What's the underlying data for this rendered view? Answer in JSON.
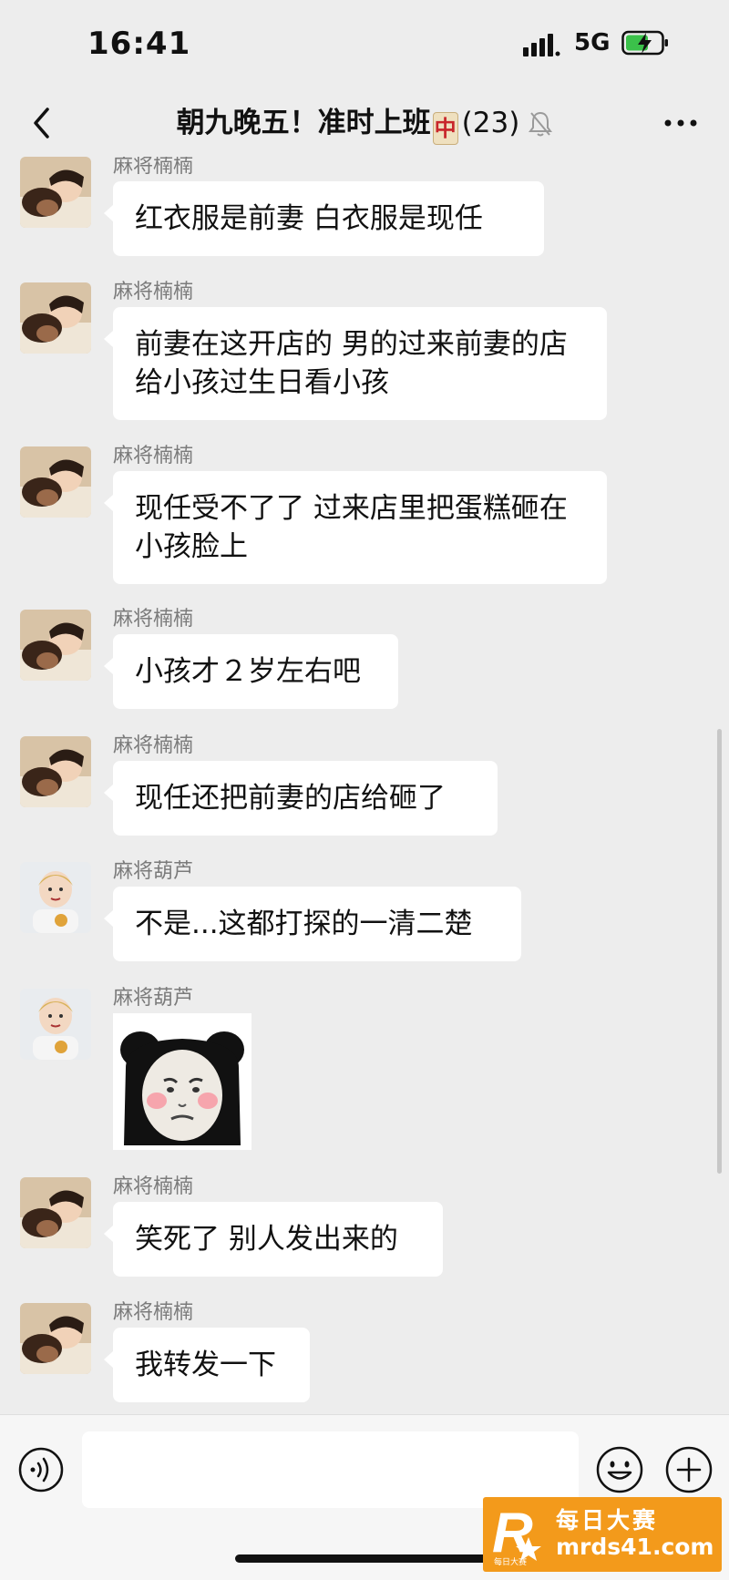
{
  "status_bar": {
    "time": "16:41",
    "network": "5G"
  },
  "nav": {
    "title": "朝九晚五！准时上班",
    "tile_char": "中",
    "count": "(23)"
  },
  "messages": [
    {
      "sender": "麻将楠楠",
      "text": "红衣服是前妻  白衣服是现任"
    },
    {
      "sender": "麻将楠楠",
      "text": "前妻在这开店的  男的过来前妻的店给小孩过生日看小孩"
    },
    {
      "sender": "麻将楠楠",
      "text": "现任受不了了  过来店里把蛋糕砸在小孩脸上"
    },
    {
      "sender": "麻将楠楠",
      "text": "小孩才２岁左右吧"
    },
    {
      "sender": "麻将楠楠",
      "text": "现任还把前妻的店给砸了"
    },
    {
      "sender": "麻将葫芦",
      "text": "不是...这都打探的一清二楚"
    },
    {
      "sender": "麻将葫芦",
      "sticker": "panda-meme-sticker"
    },
    {
      "sender": "麻将楠楠",
      "text": "笑死了 别人发出来的"
    },
    {
      "sender": "麻将楠楠",
      "text": "我转发一下"
    }
  ],
  "input_bar": {
    "text": ""
  },
  "watermark": {
    "line1": "每日大赛",
    "line2": "mrds41.com",
    "badge_small": "每日大赛"
  },
  "icons": [
    "signal-icon",
    "battery-charging-icon",
    "back-arrow-icon",
    "mute-bell-icon",
    "more-icon",
    "voice-icon",
    "emoji-icon",
    "plus-icon"
  ],
  "colors": {
    "background": "#ededed",
    "bubble": "#ffffff",
    "sender": "#7b7b7b",
    "watermark": "#f39a1b"
  }
}
